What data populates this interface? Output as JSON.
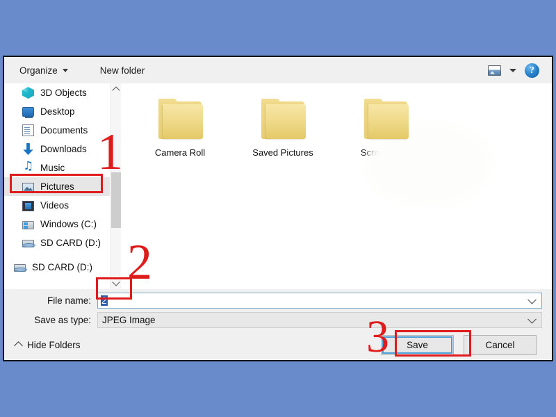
{
  "window": {
    "background_color": "#6a8bcb",
    "dialog_bg": "#f0f0f0"
  },
  "toolbar": {
    "organize_label": "Organize",
    "new_folder_label": "New folder",
    "view_icon": "picture-view-icon",
    "view_dropdown_icon": "chevron-down-icon",
    "help_label": "?"
  },
  "sidebar": {
    "items": [
      {
        "label": "3D Objects",
        "icon": "cube-icon",
        "selected": false
      },
      {
        "label": "Desktop",
        "icon": "monitor-icon",
        "selected": false
      },
      {
        "label": "Documents",
        "icon": "document-icon",
        "selected": false
      },
      {
        "label": "Downloads",
        "icon": "download-arrow-icon",
        "selected": false
      },
      {
        "label": "Music",
        "icon": "music-note-icon",
        "selected": false
      },
      {
        "label": "Pictures",
        "icon": "picture-icon",
        "selected": true
      },
      {
        "label": "Videos",
        "icon": "video-icon",
        "selected": false
      },
      {
        "label": "Windows (C:)",
        "icon": "hard-drive-icon",
        "selected": false
      },
      {
        "label": "SD CARD (D:)",
        "icon": "removable-drive-icon",
        "selected": false
      }
    ],
    "extra_items": [
      {
        "label": "SD CARD (D:)",
        "icon": "removable-drive-icon",
        "selected": false
      }
    ],
    "scrollbar": {
      "up_icon": "chevron-up-icon",
      "down_icon": "chevron-down-icon"
    }
  },
  "file_list": {
    "items": [
      {
        "label": "Camera Roll",
        "icon": "folder-icon"
      },
      {
        "label": "Saved Pictures",
        "icon": "folder-icon"
      },
      {
        "label": "Screenshots",
        "icon": "folder-icon"
      }
    ]
  },
  "fields": {
    "file_name_label": "File name:",
    "file_name_value": "2",
    "file_name_placeholder": "",
    "save_as_type_label": "Save as type:",
    "save_as_type_value": "JPEG Image",
    "dropdown_icon": "chevron-down-icon"
  },
  "footer": {
    "hide_folders_label": "Hide Folders",
    "hide_folders_icon": "chevron-up-icon",
    "save_label": "Save",
    "cancel_label": "Cancel"
  },
  "annotations": {
    "color": "#e01b1b",
    "steps": [
      {
        "number": "1",
        "target": "sidebar-item-pictures"
      },
      {
        "number": "2",
        "target": "file-name-input"
      },
      {
        "number": "3",
        "target": "save-button"
      }
    ]
  }
}
